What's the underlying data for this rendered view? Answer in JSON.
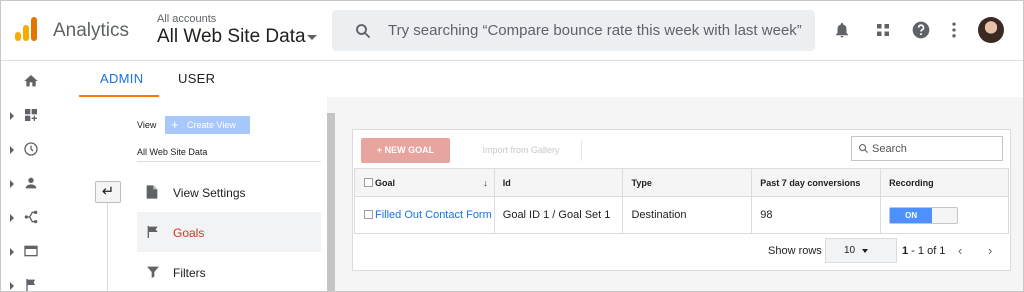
{
  "header": {
    "app_title": "Analytics",
    "account_label": "All accounts",
    "account_name": "All Web Site Data",
    "search_placeholder": "Try searching “Compare bounce rate this week with last week”"
  },
  "tabs": [
    {
      "label": "ADMIN",
      "active": true
    },
    {
      "label": "USER",
      "active": false
    }
  ],
  "view_column": {
    "label": "View",
    "create_button": "Create View",
    "selected_view": "All Web Site Data",
    "menu": [
      {
        "label": "View Settings",
        "icon": "document-icon",
        "active": false
      },
      {
        "label": "Goals",
        "icon": "flag-icon",
        "active": true
      },
      {
        "label": "Filters",
        "icon": "filter-icon",
        "active": false
      }
    ]
  },
  "goals": {
    "new_button": "+ NEW GOAL",
    "import_button": "Import from Gallery",
    "search_placeholder": "Search",
    "columns": [
      "Goal",
      "Id",
      "Type",
      "Past 7 day conversions",
      "Recording"
    ],
    "rows": [
      {
        "goal": "Filled Out Contact Form",
        "id": "Goal ID 1 / Goal Set 1",
        "type": "Destination",
        "conversions": "98",
        "recording": "ON"
      }
    ],
    "footer": {
      "show_rows_label": "Show rows",
      "rows_value": "10",
      "range_start": "1",
      "range_rest": " - 1 of 1"
    }
  },
  "colors": {
    "accent_orange": "#f57c00",
    "link_blue": "#1a73e8",
    "goals_active_red": "#d93025",
    "toggle_on_blue": "#4d90fe"
  }
}
